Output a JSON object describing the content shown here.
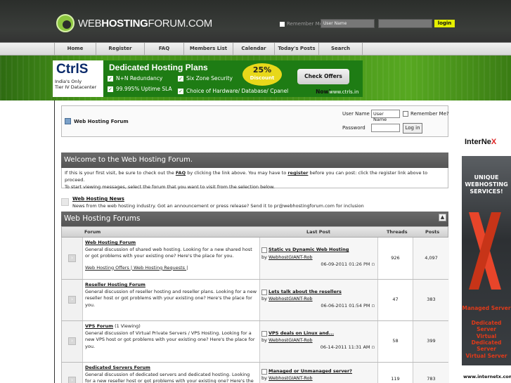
{
  "header": {
    "logo_text_a": "WEB",
    "logo_text_b": "HOSTING",
    "logo_text_c": "FORUM.COM",
    "remember_label": "Remember Me?",
    "username_placeholder": "User Name",
    "login_button": "login"
  },
  "nav": {
    "items": [
      "Home",
      "Register",
      "FAQ",
      "Members List",
      "Calendar",
      "Today's Posts",
      "Search"
    ]
  },
  "banner_ad": {
    "brand": "CtrlS",
    "subtitle_1": "India's Only",
    "subtitle_2": "Tier IV Datacenter",
    "title": "Dedicated Hosting Plans",
    "features": [
      "N+N Redundancy",
      "Six Zone Security",
      "99.995% Uptime SLA",
      "Choice of Hardware/ Database/ Cpanel"
    ],
    "discount_pct": "25%",
    "discount_label": "Discount",
    "cta": "Check Offers Now!",
    "url": "www.ctrls.in",
    "accent_color": "#1e7c14"
  },
  "side_ad": {
    "logo_a": "InterNe",
    "logo_b": "X",
    "tagline": "UNIQUE WEBHOSTING SERVICES!",
    "services": [
      "Managed Server",
      "Dedicated Server",
      "Virtual Dedicated Server",
      "Virtual Server"
    ],
    "url": "www.internetx.com"
  },
  "login_box": {
    "breadcrumb": "Web Hosting Forum",
    "username_label": "User Name",
    "username_value": "User Name",
    "remember_label": "Remember Me?",
    "password_label": "Password",
    "login_button": "Log in"
  },
  "welcome": {
    "title": "Welcome to the Web Hosting Forum.",
    "line1_a": "If this is your first visit, be sure to check out the ",
    "line1_faq": "FAQ",
    "line1_b": " by clicking the link above. You may have to ",
    "line1_reg": "register",
    "line1_c": " before you can post: click the register link above to proceed.",
    "line2": "To start viewing messages, select the forum that you want to visit from the selection below."
  },
  "news": {
    "title": "Web Hosting News",
    "desc": "News from the web hosting industry. Got an announcement or press release? Send it to pr@webhostingforum.com for inclusion"
  },
  "forums": {
    "title": "Web Hosting Forums",
    "col_forum": "Forum",
    "col_last": "Last Post",
    "col_threads": "Threads",
    "col_posts": "Posts",
    "rows": [
      {
        "title": "Web Hosting Forum",
        "viewing": "",
        "desc": "General discussion of shared web hosting. Looking for a new shared host or got problems with your existing one? Here's the place for you.",
        "sub": "Web Hosting Offers | Web Hosting Requests |",
        "last_title": "Static vs Dynamic Web Hosting",
        "by": "by ",
        "last_user": "WebhostGIANT-Rob",
        "last_date": "06-09-2011",
        "last_time": "01:26 PM",
        "threads": "926",
        "posts": "4,097"
      },
      {
        "title": "Reseller Hosting Forum",
        "viewing": "",
        "desc": "General discussion of reseller hosting and reseller plans. Looking for a new reseller host or got problems with your existing one? Here's the place for you.",
        "sub": "",
        "last_title": "Lets talk about the resellers",
        "by": "by ",
        "last_user": "WebhostGIANT-Rob",
        "last_date": "06-06-2011",
        "last_time": "01:54 PM",
        "threads": "47",
        "posts": "383"
      },
      {
        "title": "VPS Forum",
        "viewing": " (1 Viewing)",
        "desc": "General discussion of Virtual Private Servers / VPS Hosting. Looking for a new VPS host or got problems with your existing one? Here's the place for you.",
        "sub": "",
        "last_title": "VPS deals on Linux and...",
        "by": "by ",
        "last_user": "WebhostGIANT-Rob",
        "last_date": "06-14-2011",
        "last_time": "11:31 AM",
        "threads": "58",
        "posts": "399"
      },
      {
        "title": "Dedicated Servers Forum",
        "viewing": "",
        "desc": "General discussion of dedicated servers and dedicated hosting. Looking for a new reseller host or got problems with your existing one? Here's the",
        "sub": "",
        "last_title": "Managed or Unmanaged server?",
        "by": "by ",
        "last_user": "WebhostGIANT-Rob",
        "last_date": "",
        "last_time": "",
        "threads": "119",
        "posts": "783"
      }
    ]
  }
}
